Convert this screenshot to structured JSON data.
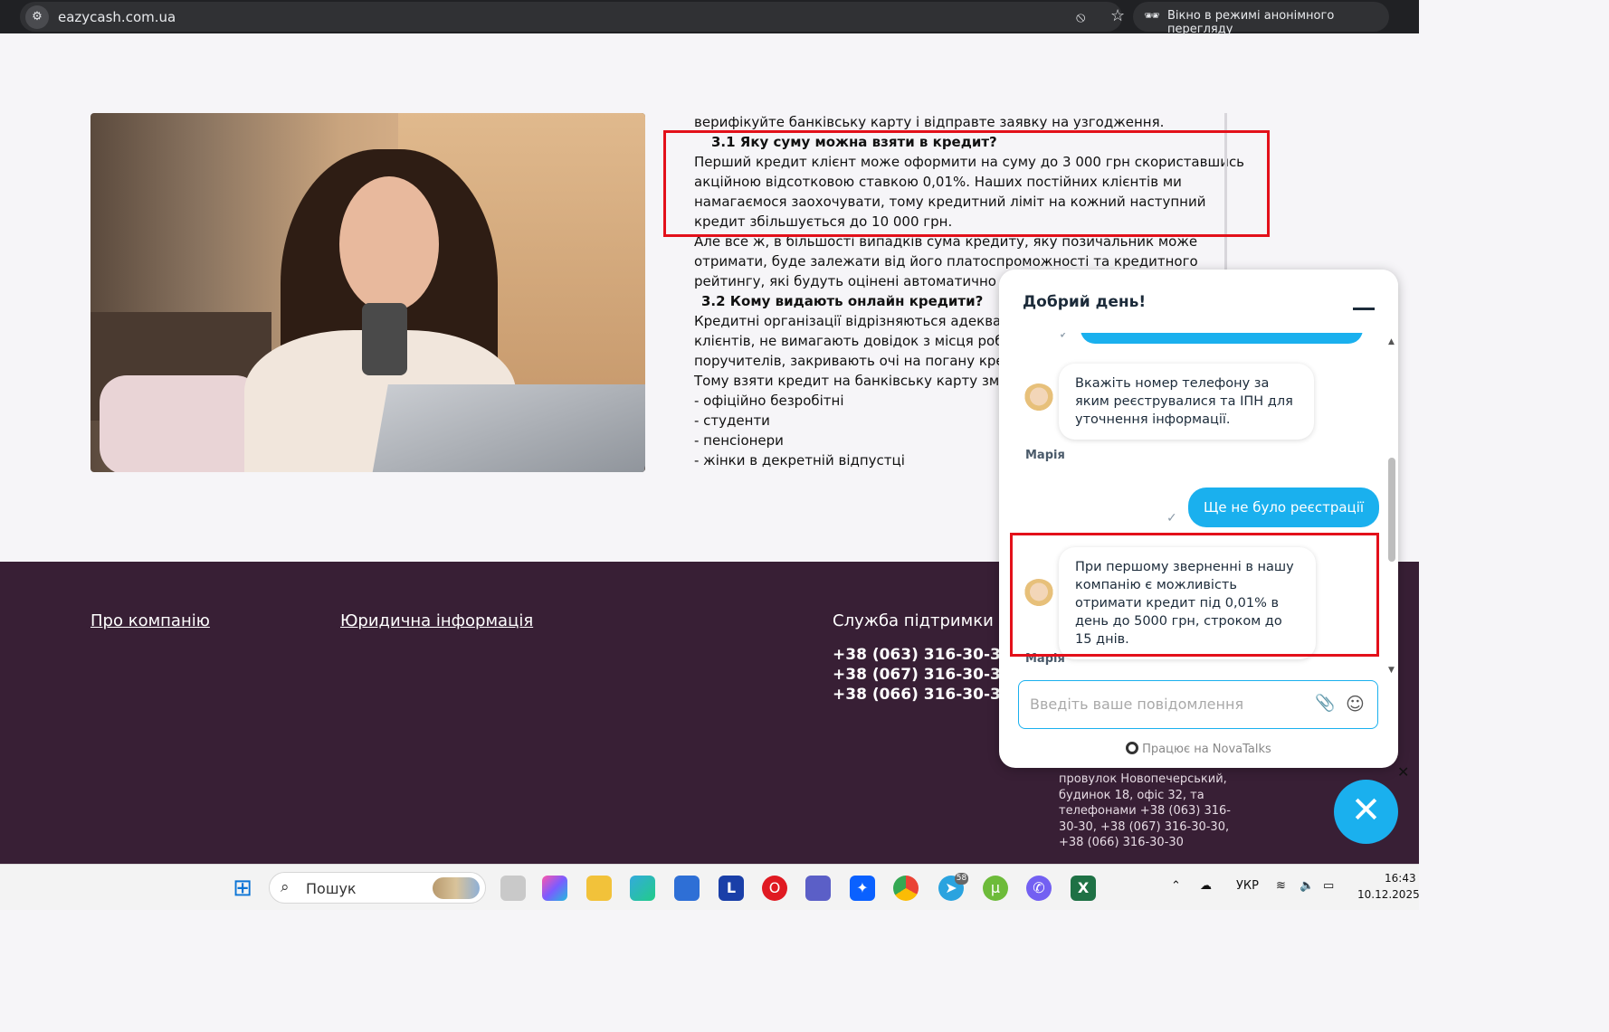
{
  "browser": {
    "url": "eazycash.com.ua",
    "incognito_label": "Вікно в режимі анонімного перегляду",
    "icons": {
      "site_info": "tune-icon",
      "hide": "eye-off-icon",
      "bookmark": "star-icon",
      "incognito": "incognito-icon"
    }
  },
  "article": {
    "line0": "верифікуйте банківську карту і відправте заявку на узгодження.",
    "h31": "3.1 Яку суму можна взяти в кредит?",
    "p31": [
      "Перший кредит клієнт може оформити на суму до 3 000 грн скориставшись",
      "акційною відсотковою ставкою 0,01%. Наших постійних клієнтів ми",
      "намагаємося заохочувати, тому кредитний ліміт на кожний наступний",
      "кредит збільшується до 10 000 грн."
    ],
    "p31b": [
      "Але все ж, в більшості випадків сума кредиту, яку позичальник може",
      "отримати, буде залежати від його платоспроможності та кредитного",
      "рейтингу, які будуть оцінені автоматично наш"
    ],
    "h32": "3.2 Кому видають онлайн кредити?",
    "p32": [
      "Кредитні організації відрізняються адекватни",
      "клієнтів, не вимагають довідок з місця роботи",
      "поручителів, закривають очі на погану кредит",
      "Тому взяти кредит на банківську карту зможут"
    ],
    "list": [
      "- офіційно безробітні",
      "- студенти",
      "- пенсіонери",
      "- жінки в декретній відпустці"
    ]
  },
  "footer": {
    "about": "Про компанію",
    "legal": "Юридична інформація",
    "support_title": "Служба підтримки",
    "phones": [
      "+38 (063) 316-30-30",
      "+38 (067) 316-30-30",
      "+38 (066) 316-30-30"
    ],
    "address": "провулок Новопечерський, будинок 18, офіс 32, та телефонами +38 (063) 316-30-30, +38 (067) 316-30-30, +38 (066) 316-30-30"
  },
  "chat": {
    "title": "Добрий день!",
    "msg_in_1": "Вкажіть номер телефону за яким реєструвалися та ІПН для уточнення інформації.",
    "sender_1": "Марія",
    "msg_out_1": "Ще не було реєстрації",
    "msg_in_2": "При першому зверненні в нашу компанію є можливість отримати кредит під 0,01% в день до 5000 грн, строком до 15 днів.",
    "sender_2": "Марія",
    "placeholder": "Введіть ваше повідомлення",
    "powered": "Працює на NovaTalks",
    "icons": {
      "attach": "paperclip-icon",
      "emoji": "emoji-icon",
      "minimize": "minimize-icon",
      "close": "close-icon"
    }
  },
  "taskbar": {
    "search_label": "Пошук",
    "telegram_badge": "58",
    "lang": "УКР",
    "time": "16:43",
    "date": "10.12.2025"
  }
}
